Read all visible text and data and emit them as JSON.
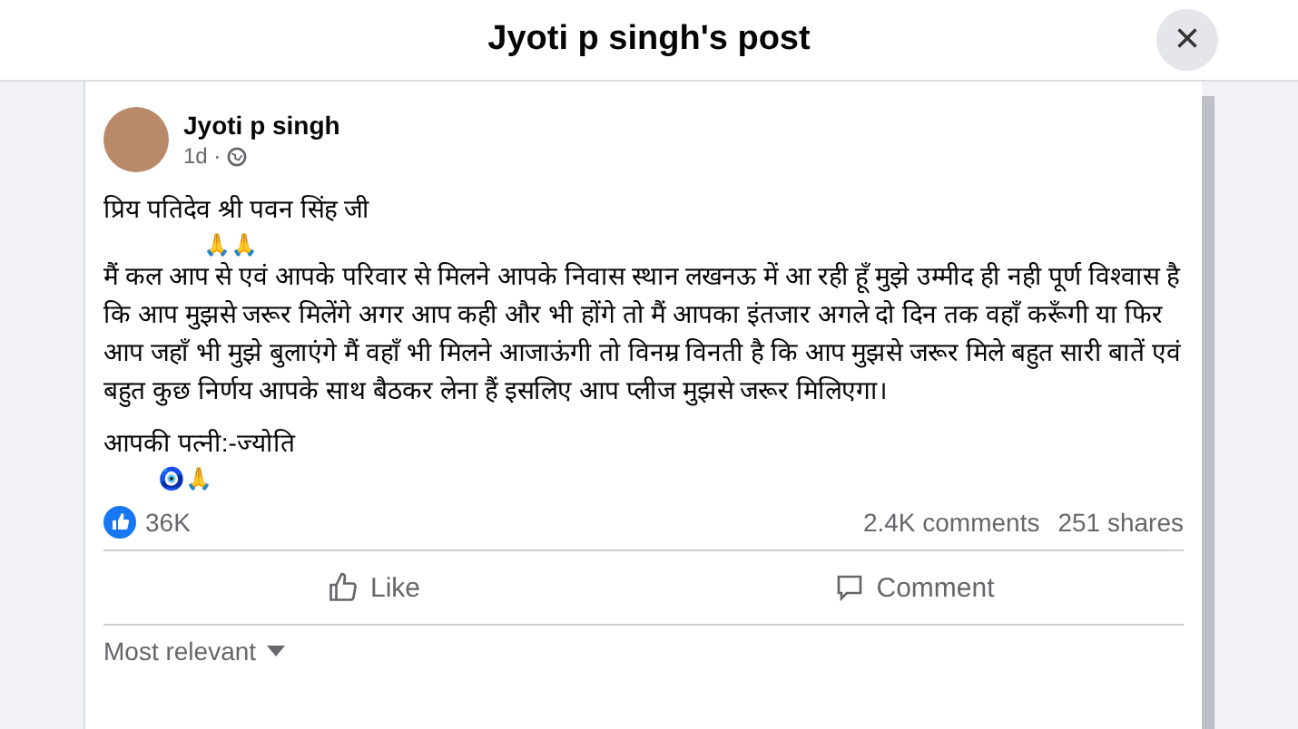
{
  "dialog": {
    "title": "Jyoti p singh's post",
    "close": "×"
  },
  "post": {
    "author": "Jyoti p singh",
    "time": "1d ·",
    "greeting": "प्रिय पतिदेव श्री पवन सिंह जी",
    "emoji_line": "🙏🙏",
    "body": "मैं कल आप से एवं आपके परिवार से मिलने आपके निवास स्थान लखनऊ में आ रही हूँ मुझे उम्मीद ही नही पूर्ण विश्वास है कि आप मुझसे जरूर मिलेंगे अगर आप कही और भी होंगे तो मैं आपका इंतजार अगले दो दिन तक वहाँ करूँगी या फिर आप जहाँ भी मुझे बुलाएंगे  मैं वहाँ भी मिलने आजाऊंगी तो विनम्र विनती है कि आप मुझसे जरूर मिले बहुत सारी बातें एवं बहुत कुछ निर्णय आपके साथ बैठकर लेना हैं इसलिए आप प्लीज मुझसे जरूर मिलिएगा।",
    "signature": "आपकी पत्नी:-ज्योति",
    "signature_emoji": "🧿🙏",
    "likes": "36K",
    "comments": "2.4K comments",
    "shares": "251 shares"
  },
  "actions": [
    {
      "kind": "like",
      "label": "Like"
    },
    {
      "kind": "comment",
      "label": "Comment"
    }
  ],
  "sort": {
    "label": "Most relevant"
  }
}
